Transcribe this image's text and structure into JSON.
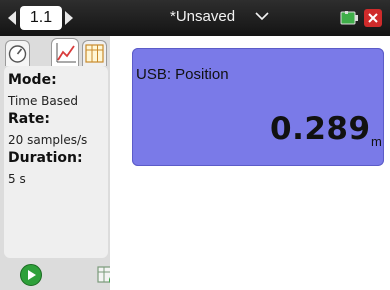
{
  "header": {
    "page_tab": "1.1",
    "doc_title": "*Unsaved"
  },
  "panel": {
    "tabs": [
      {
        "icon": "meter-icon"
      },
      {
        "icon": "graph-icon",
        "selected": true
      },
      {
        "icon": "table-icon"
      }
    ],
    "mode_label": "Mode:",
    "mode_value": "Time Based",
    "rate_label": "Rate:",
    "rate_value": "20 samples/s",
    "duration_label": "Duration:",
    "duration_value": "5 s"
  },
  "meter": {
    "label": "USB: Position",
    "value": "0.289",
    "unit": "m",
    "color": "#7a7ae8"
  },
  "toolbar": {
    "play_icon": "play-icon",
    "store_icon": "store-data-icon"
  }
}
